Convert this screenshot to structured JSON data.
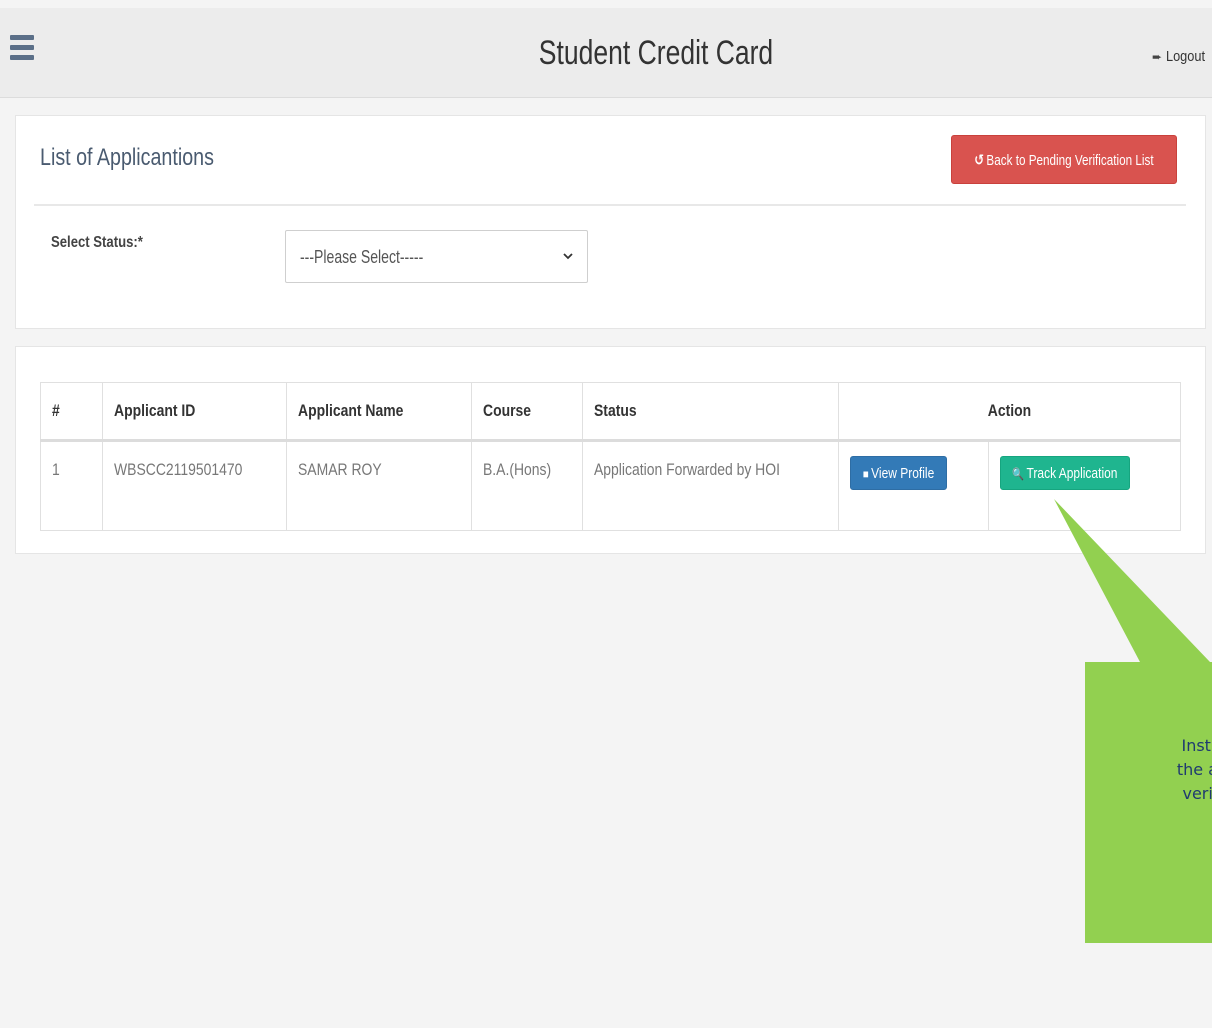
{
  "header": {
    "title": "Student Credit Card",
    "menu_icon": "hamburger-menu-icon",
    "logout_label": "Logout",
    "logout_icon": "sign-out-icon"
  },
  "filter_panel": {
    "title": "List of Applicantions",
    "back_button_label": "Back to Pending Verification List",
    "back_button_icon": "undo-icon",
    "status_label": "Select Status:*",
    "status_select_value": "---Please Select-----"
  },
  "table": {
    "columns": [
      "#",
      "Applicant ID",
      "Applicant Name",
      "Course",
      "Status",
      "Action"
    ],
    "rows": [
      {
        "index": "1",
        "applicant_id": "WBSCC2119501470",
        "applicant_name": "SAMAR ROY",
        "course": "B.A.(Hons)",
        "status": "Application Forwarded by HOI",
        "view_profile_label": "View Profile",
        "track_application_label": "Track Application"
      }
    ]
  },
  "callout": {
    "lines": [
      "Instituti",
      "the appli",
      "verifica"
    ],
    "color": "#92d050"
  },
  "colors": {
    "danger": "#d9534f",
    "primary": "#337ab7",
    "success": "#1fb58f"
  }
}
